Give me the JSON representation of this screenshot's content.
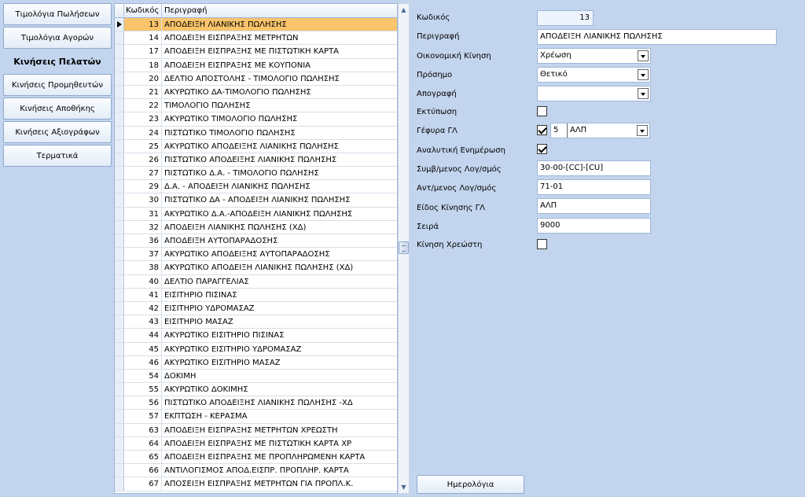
{
  "nav": [
    "Τιμολόγια Πωλήσεων",
    "Τιμολόγια Αγορών",
    "Κινήσεις Πελατών",
    "Κινήσεις Προμηθευτών",
    "Κινήσεις Αποθήκης",
    "Κινήσεις Αξιογράφων",
    "Τερματικά"
  ],
  "grid": {
    "col_code": "Κωδικός",
    "col_desc": "Περιγραφή",
    "rows": [
      {
        "code": "13",
        "desc": "ΑΠΟΔΕΙΞΗ ΛΙΑΝΙΚΗΣ ΠΩΛΗΣΗΣ"
      },
      {
        "code": "14",
        "desc": "ΑΠΟΔΕΙΞΗ ΕΙΣΠΡΑΞΗΣ ΜΕΤΡΗΤΩΝ"
      },
      {
        "code": "17",
        "desc": "ΑΠΟΔΕΙΞΗ ΕΙΣΠΡΑΞΗΣ ΜΕ ΠΙΣΤΩΤΙΚΗ ΚΑΡΤΑ"
      },
      {
        "code": "18",
        "desc": "ΑΠΟΔΕΙΞΗ ΕΙΣΠΡΑΞΗΣ ΜΕ ΚΟΥΠΟΝΙΑ"
      },
      {
        "code": "20",
        "desc": "ΔΕΛΤΙΟ ΑΠΟΣΤΟΛΗΣ - ΤΙΜΟΛΟΓΙΟ ΠΩΛΗΣΗΣ"
      },
      {
        "code": "21",
        "desc": "ΑΚΥΡΩΤΙΚΟ ΔΑ-ΤΙΜΟΛΟΓΙΟ ΠΩΛΗΣΗΣ"
      },
      {
        "code": "22",
        "desc": "ΤΙΜΟΛΟΓΙΟ ΠΩΛΗΣΗΣ"
      },
      {
        "code": "23",
        "desc": "ΑΚΥΡΩΤΙΚΟ ΤΙΜΟΛΟΓΙΟ ΠΩΛΗΣΗΣ"
      },
      {
        "code": "24",
        "desc": "ΠΙΣΤΩΤΙΚΟ ΤΙΜΟΛΟΓΙΟ ΠΩΛΗΣΗΣ"
      },
      {
        "code": "25",
        "desc": "ΑΚΥΡΩΤΙΚΟ ΑΠΟΔΕΙΞΗΣ ΛΙΑΝΙΚΗΣ ΠΩΛΗΣΗΣ"
      },
      {
        "code": "26",
        "desc": "ΠΙΣΤΩΤΙΚΟ ΑΠΟΔΕΙΞΗΣ ΛΙΑΝΙΚΗΣ ΠΩΛΗΣΗΣ"
      },
      {
        "code": "27",
        "desc": "ΠΙΣΤΩΤΙΚΟ Δ.Α. - ΤΙΜΟΛΟΓΙΟ ΠΩΛΗΣΗΣ"
      },
      {
        "code": "29",
        "desc": "Δ.Α. - ΑΠΟΔΕΙΞΗ ΛΙΑΝΙΚΗΣ ΠΩΛΗΣΗΣ"
      },
      {
        "code": "30",
        "desc": "ΠΙΣΤΩΤΙΚΟ ΔΑ - ΑΠΟΔΕΙΞΗ ΛΙΑΝΙΚΗΣ ΠΩΛΗΣΗΣ"
      },
      {
        "code": "31",
        "desc": "ΑΚΥΡΩΤΙΚΟ Δ.Α.-ΑΠΟΔΕΙΞΗ ΛΙΑΝΙΚΗΣ ΠΩΛΗΣΗΣ"
      },
      {
        "code": "32",
        "desc": "ΑΠΟΔΕΙΞΗ ΛΙΑΝΙΚΗΣ ΠΩΛΗΣΗΣ (ΧΔ)"
      },
      {
        "code": "36",
        "desc": "ΑΠΟΔΕΙΞΗ ΑΥΤΟΠΑΡΑΔΟΣΗΣ"
      },
      {
        "code": "37",
        "desc": "ΑΚΥΡΩΤΙΚΟ ΑΠΟΔΕΙΞΗΣ ΑΥΤΟΠΑΡΑΔΟΣΗΣ"
      },
      {
        "code": "38",
        "desc": "ΑΚΥΡΩΤΙΚΟ ΑΠΟΔΕΙΞΗ ΛΙΑΝΙΚΗΣ ΠΩΛΗΣΗΣ (ΧΔ)"
      },
      {
        "code": "40",
        "desc": "ΔΕΛΤΙΟ ΠΑΡΑΓΓΕΛΙΑΣ"
      },
      {
        "code": "41",
        "desc": "ΕΙΣΙΤΗΡΙΟ ΠΙΣΙΝΑΣ"
      },
      {
        "code": "42",
        "desc": "ΕΙΣΙΤΗΡΙΟ ΥΔΡΟΜΑΣΑΖ"
      },
      {
        "code": "43",
        "desc": "ΕΙΣΙΤΗΡΙΟ ΜΑΣΑΖ"
      },
      {
        "code": "44",
        "desc": "ΑΚΥΡΩΤΙΚΟ ΕΙΣΙΤΗΡΙΟ ΠΙΣΙΝΑΣ"
      },
      {
        "code": "45",
        "desc": "ΑΚΥΡΩΤΙΚΟ ΕΙΣΙΤΗΡΙΟ ΥΔΡΟΜΑΣΑΖ"
      },
      {
        "code": "46",
        "desc": "ΑΚΥΡΩΤΙΚΟ ΕΙΣΙΤΗΡΙΟ ΜΑΣΑΖ"
      },
      {
        "code": "54",
        "desc": "ΔΟΚΙΜΗ"
      },
      {
        "code": "55",
        "desc": "ΑΚΥΡΩΤΙΚΟ ΔΟΚΙΜΗΣ"
      },
      {
        "code": "56",
        "desc": "ΠΙΣΤΩΤΙΚΟ ΑΠΟΔΕΙΞΗΣ ΛΙΑΝΙΚΗΣ ΠΩΛΗΣΗΣ -ΧΔ"
      },
      {
        "code": "57",
        "desc": "ΕΚΠΤΩΣΗ - ΚΕΡΑΣΜΑ"
      },
      {
        "code": "63",
        "desc": "ΑΠΟΔΕΙΞΗ ΕΙΣΠΡΑΞΗΣ ΜΕΤΡΗΤΩΝ ΧΡΕΩΣΤΗ"
      },
      {
        "code": "64",
        "desc": "ΑΠΟΔΕΙΞΗ ΕΙΣΠΡΑΞΗΣ ΜΕ ΠΙΣΤΩΤΙΚΗ ΚΑΡΤΑ ΧΡ"
      },
      {
        "code": "65",
        "desc": "ΑΠΟΔΕΙΞΗ ΕΙΣΠΡΑΞΗΣ ΜΕ ΠΡΟΠΛΗΡΩΜΕΝΗ ΚΑΡΤΑ"
      },
      {
        "code": "66",
        "desc": "ΑΝΤΙΛΟΓΙΣΜΟΣ ΑΠΟΔ.ΕΙΣΠΡ. ΠΡΟΠΛΗΡ. ΚΑΡΤΑ"
      },
      {
        "code": "67",
        "desc": "ΑΠΟΣΕΙΞΗ ΕΙΣΠΡΑΞΗΣ ΜΕΤΡΗΤΩΝ ΓΙΑ ΠΡΟΠΛ.Κ."
      }
    ]
  },
  "form": {
    "code_label": "Κωδικός",
    "code_value": "13",
    "desc_label": "Περιγραφή",
    "desc_value": "ΑΠΟΔΕΙΞΗ ΛΙΑΝΙΚΗΣ ΠΩΛΗΣΗΣ",
    "econ_label": "Οικονομική Κίνηση",
    "econ_value": "Χρέωση",
    "sign_label": "Πρόσημο",
    "sign_value": "Θετικό",
    "inventory_label": "Απογραφή",
    "inventory_value": "",
    "print_label": "Εκτύπωση",
    "bridge_label": "Γέφυρα ΓΛ",
    "bridge_num": "5",
    "bridge_value": "ΑΛΠ",
    "analytic_label": "Αναλυτική Ενημέρωση",
    "assoc_label": "Συμβ/μενος Λογ/σμός",
    "assoc_value": "30-00-[CC]-[CU]",
    "counter_label": "Αντ/μενος Λογ/σμός",
    "counter_value": "71-01",
    "gl_type_label": "Είδος Κίνησης ΓΛ",
    "gl_type_value": "ΑΛΠ",
    "series_label": "Σειρά",
    "series_value": "9000",
    "debtor_label": "Κίνηση Χρεώστη",
    "calendar_button": "Ημερολόγια"
  },
  "colors": {
    "background": "#c3d5ee",
    "selected_row": "#f9c46b"
  }
}
